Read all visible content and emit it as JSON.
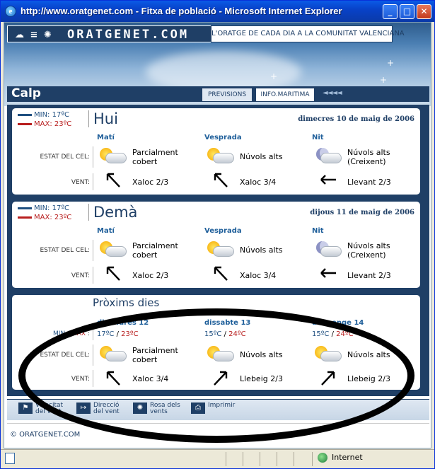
{
  "window": {
    "title": "http://www.oratgenet.com - Fitxa de població - Microsoft Internet Explorer",
    "buttons": {
      "minimize": "_",
      "maximize": "□",
      "close": "✕"
    }
  },
  "header": {
    "logo_icons": "☁ ≡ ✺",
    "logo_text": "ORATGENET.COM",
    "tagline": "L'ORATGE DE CADA DIA A LA COMUNITAT VALENCIANA"
  },
  "nav": {
    "city": "Calp",
    "tabs": [
      "PREVISIONS",
      "INFO.MARITIMA"
    ],
    "arrows": "◄◄◄◄"
  },
  "labels": {
    "min": "MIN",
    "max": "MAX",
    "sky": "ESTAT DEL CEL:",
    "wind": "VENT:",
    "minmax_row": "MIN / MAX :",
    "slash": "/"
  },
  "today": {
    "min": "MIN: 17ºC",
    "max": "MAX: 23ºC",
    "title": "Hui",
    "date": "dimecres 10 de maig de 2006",
    "periods": [
      {
        "name": "Matí",
        "icon": "sun-cloud-icon",
        "sky": [
          "Parcialment",
          "cobert"
        ],
        "wind_icon": "arrow-nw-icon",
        "wind": "Xaloc 2/3"
      },
      {
        "name": "Vesprada",
        "icon": "sun-cloud-icon",
        "sky": [
          "Núvols alts",
          ""
        ],
        "wind_icon": "arrow-nw-icon",
        "wind": "Xaloc 3/4"
      },
      {
        "name": "Nit",
        "icon": "moon-cloud-icon",
        "sky": [
          "Núvols alts",
          "(Creixent)"
        ],
        "wind_icon": "arrow-left-icon",
        "wind": "Llevant 2/3"
      }
    ]
  },
  "tomorrow": {
    "min": "MIN: 17ºC",
    "max": "MAX: 23ºC",
    "title": "Demà",
    "date": "dijous 11 de maig de 2006",
    "periods": [
      {
        "name": "Matí",
        "icon": "sun-cloud-icon",
        "sky": [
          "Parcialment",
          "cobert"
        ],
        "wind_icon": "arrow-nw-icon",
        "wind": "Xaloc 2/3"
      },
      {
        "name": "Vesprada",
        "icon": "sun-cloud-icon",
        "sky": [
          "Núvols alts",
          ""
        ],
        "wind_icon": "arrow-nw-icon",
        "wind": "Xaloc 3/4"
      },
      {
        "name": "Nit",
        "icon": "moon-cloud-icon",
        "sky": [
          "Núvols alts",
          "(Creixent)"
        ],
        "wind_icon": "arrow-left-icon",
        "wind": "Llevant 2/3"
      }
    ]
  },
  "next": {
    "title": "Pròxims dies",
    "days": [
      {
        "name": "divendres 12",
        "min": "17ºC",
        "max": "23ºC",
        "icon": "sun-cloud-icon",
        "sky": [
          "Parcialment",
          "cobert"
        ],
        "wind_icon": "arrow-nw-icon",
        "wind": "Xaloc 3/4"
      },
      {
        "name": "dissabte 13",
        "min": "15ºC",
        "max": "24ºC",
        "icon": "sun-cloud-icon",
        "sky": [
          "Núvols alts",
          ""
        ],
        "wind_icon": "arrow-ne-icon",
        "wind": "Llebeig 2/3"
      },
      {
        "name": "diumenge 14",
        "min": "15ºC",
        "max": "24ºC",
        "icon": "sun-cloud-icon",
        "sky": [
          "Núvols alts",
          ""
        ],
        "wind_icon": "arrow-ne-icon",
        "wind": "Llebeig 2/3"
      }
    ]
  },
  "legend": [
    {
      "icon": "flag-icon",
      "glyph": "⚑",
      "line1": "Velocitat",
      "line2": "del vent"
    },
    {
      "icon": "direction-icon",
      "glyph": "↦",
      "line1": "Direcció",
      "line2": "del vent"
    },
    {
      "icon": "compass-rose-icon",
      "glyph": "✺",
      "line1": "Rosa dels",
      "line2": "vents"
    },
    {
      "icon": "printer-icon",
      "glyph": "⎙",
      "line1": "Imprimir",
      "line2": ""
    }
  ],
  "footer": {
    "copyright": "© ORATGENET.COM"
  },
  "status": {
    "zone": "Internet"
  },
  "colors": {
    "navy": "#1f3f66",
    "min_blue": "#1f4f80",
    "max_red": "#b81e1e"
  }
}
